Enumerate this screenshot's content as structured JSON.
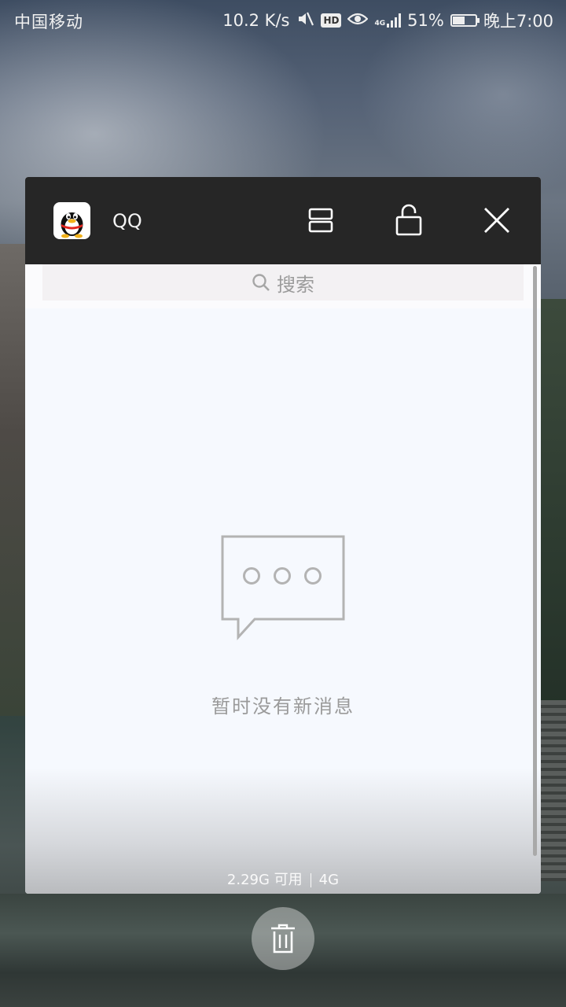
{
  "status_bar": {
    "carrier": "中国移动",
    "net_speed": "10.2 K/s",
    "hd_label": "HD",
    "net_type": "4G",
    "battery": "51%",
    "time": "晚上7:00"
  },
  "app_card": {
    "app_name": "QQ",
    "search_placeholder": "搜索",
    "empty_message": "暂时没有新消息"
  },
  "memory": {
    "available": "2.29G 可用",
    "total": "4G"
  },
  "icons": [
    "mute-icon",
    "eye-icon",
    "signal-icon",
    "battery-icon",
    "split-screen-icon",
    "unlock-icon",
    "close-icon",
    "search-icon",
    "chat-bubble-icon",
    "trash-icon"
  ]
}
